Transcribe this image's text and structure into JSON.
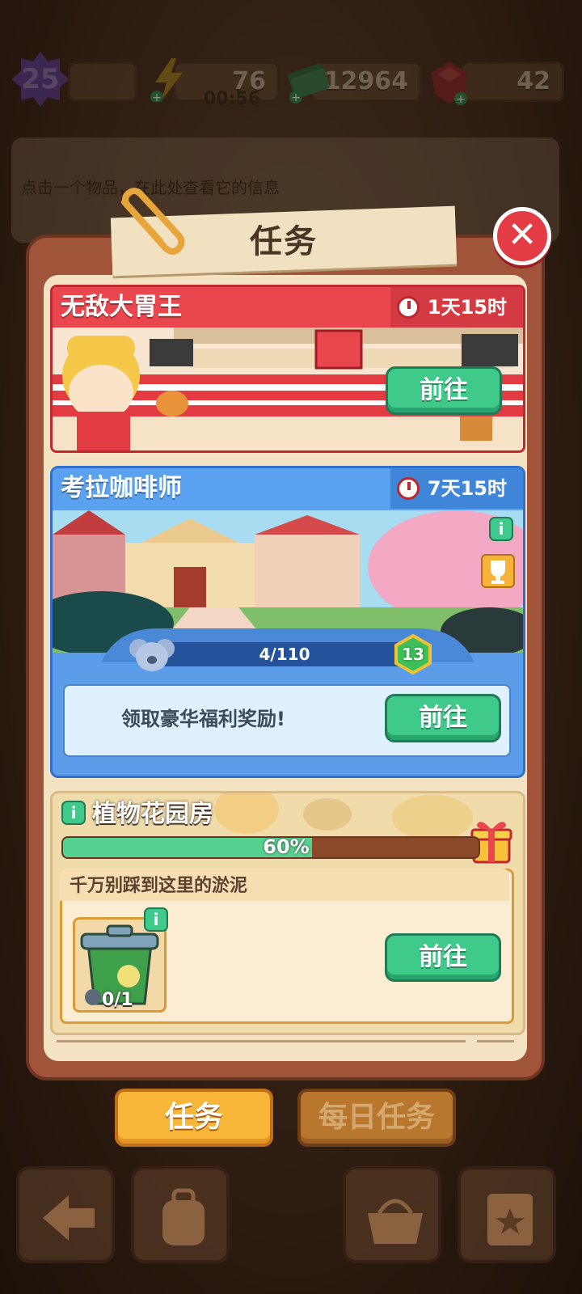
{
  "hud": {
    "level": "25",
    "energy": "76",
    "energy_timer": "00:56",
    "cash": "12964",
    "gems": "42",
    "info_hint": "点击一个物品，在此处查看它的信息"
  },
  "panel": {
    "title": "任务"
  },
  "events": [
    {
      "title": "无敌大胃王",
      "timer": "1天15时",
      "button": "前往",
      "color": "#e9474d"
    },
    {
      "title": "考拉咖啡师",
      "timer": "7天15时",
      "progress_text": "4/110",
      "progress": 0.036,
      "level_badge": "13",
      "reward_text": "领取豪华福利奖励!",
      "button": "前往",
      "color": "#5aa2ef"
    }
  ],
  "area": {
    "title": "植物花园房",
    "progress_text": "60%",
    "progress": 0.6,
    "task_text": "千万别踩到这里的淤泥",
    "item_count": "0/1",
    "button": "前往"
  },
  "tabs": {
    "quests": "任务",
    "daily": "每日任务"
  }
}
